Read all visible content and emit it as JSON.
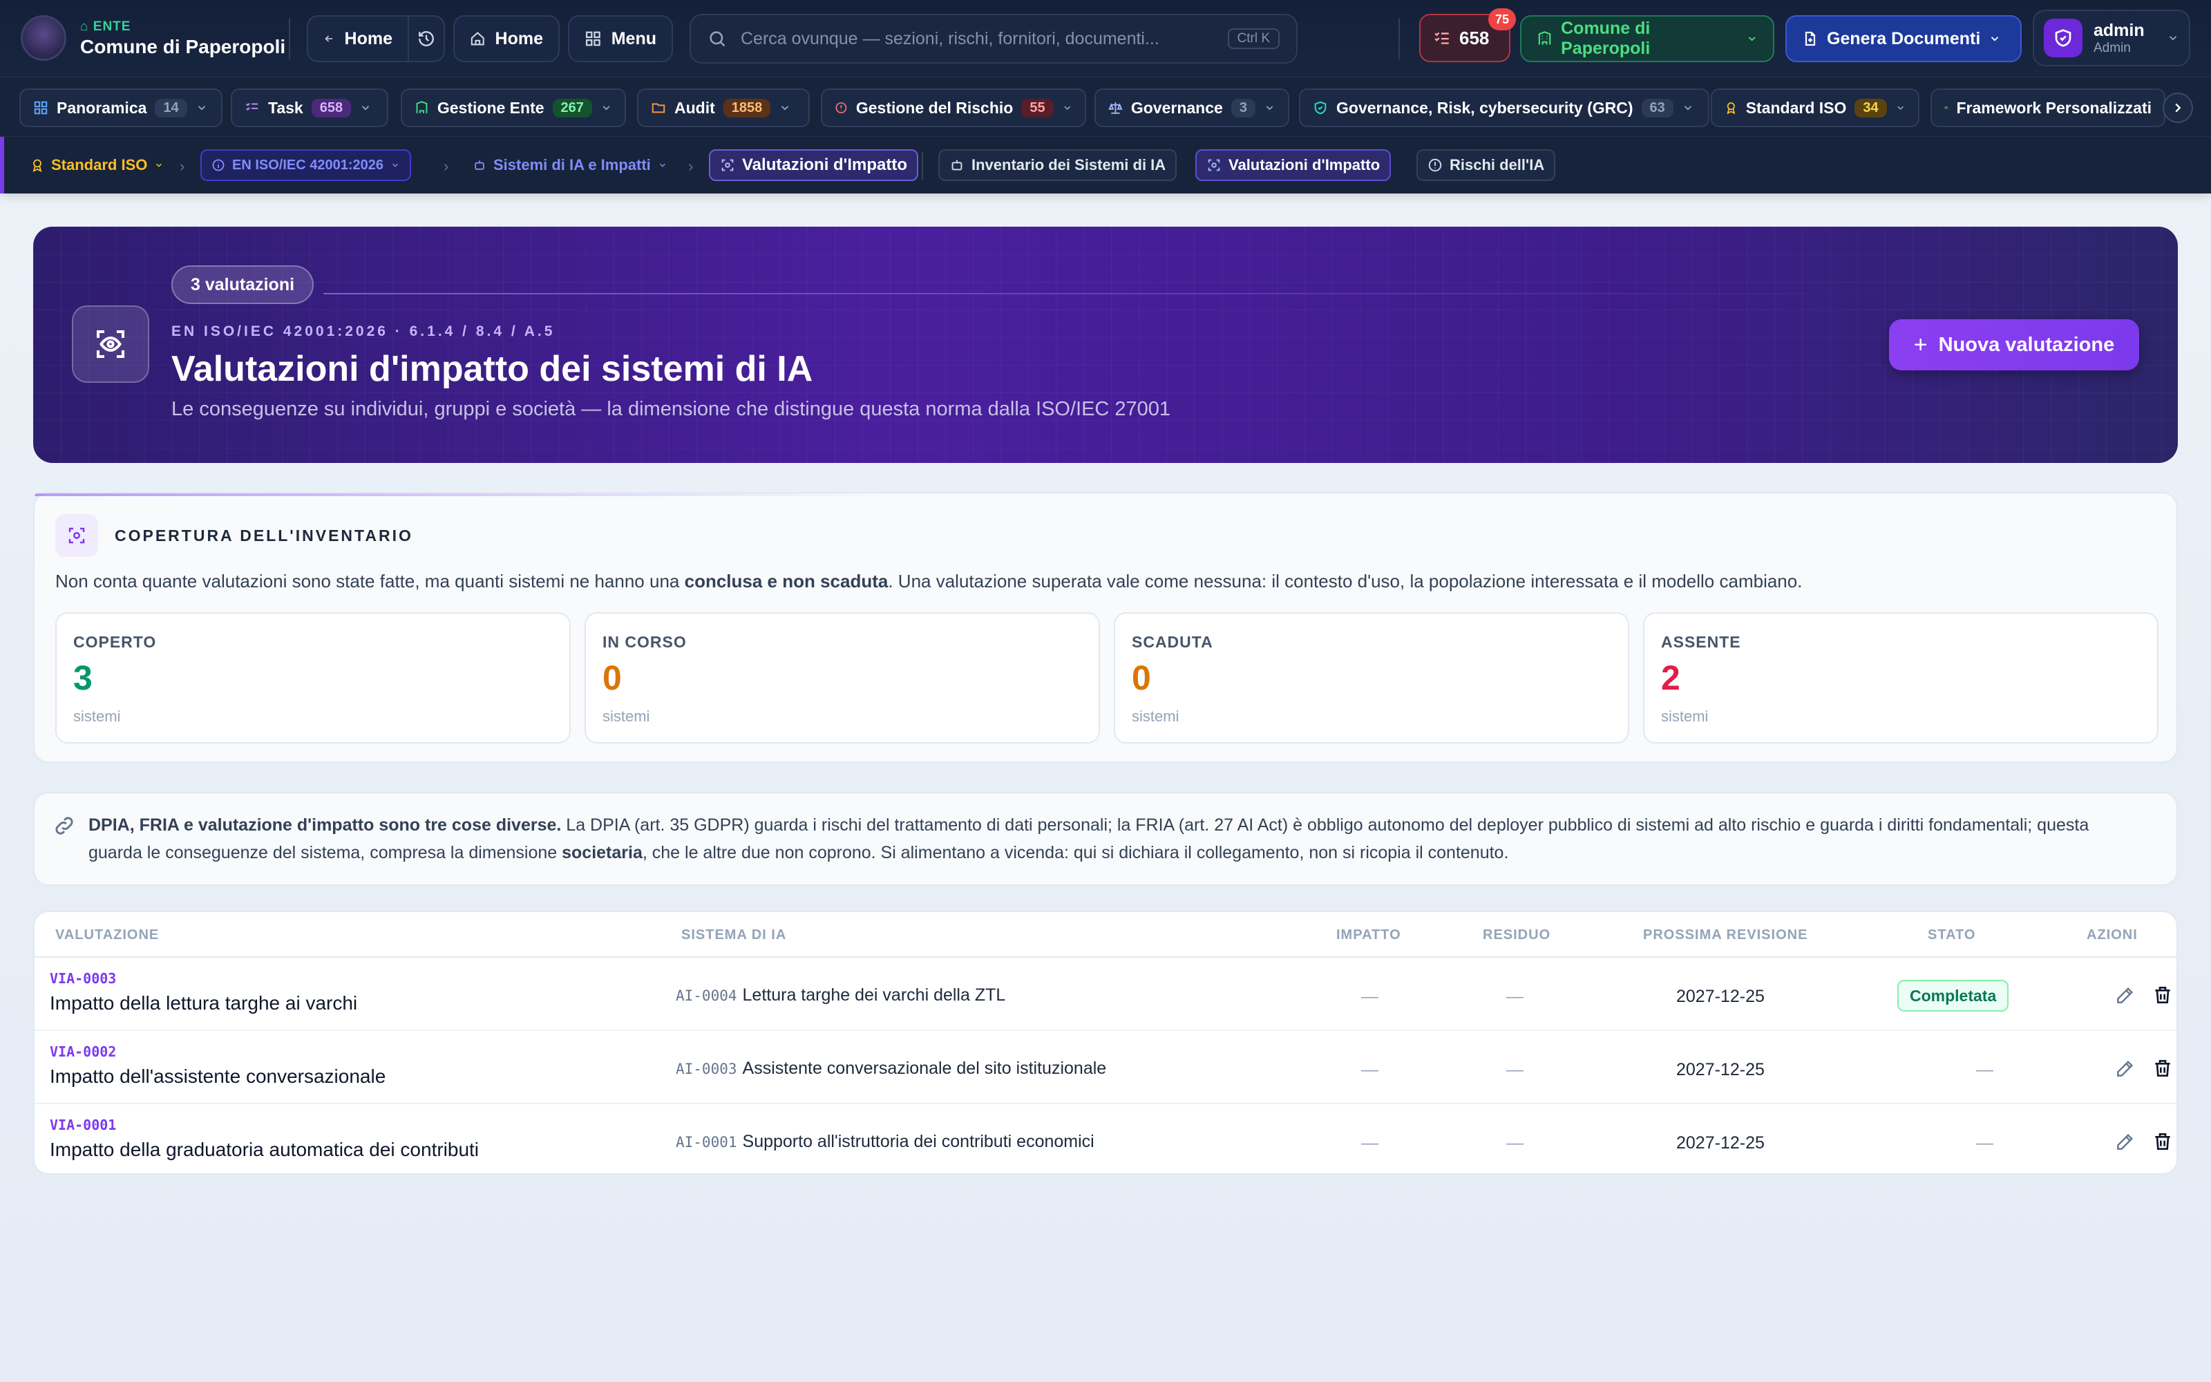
{
  "header": {
    "ente_label": "ENTE",
    "ente_name": "Comune di Paperopoli",
    "back_label": "Home",
    "home_label": "Home",
    "menu_label": "Menu",
    "search_placeholder": "Cerca ovunque — sezioni, rischi, fornitori, documenti...",
    "search_shortcut": "Ctrl K",
    "tasks_count": "658",
    "tasks_badge": "75",
    "ente_selector": "Comune di Paperopoli",
    "generate_label": "Genera Documenti",
    "user_name": "admin",
    "user_role": "Admin"
  },
  "modules": [
    {
      "label": "Panoramica",
      "count": "14",
      "color": "#60a5fa",
      "count_bg": "#2c3a57",
      "count_color": "#94a3b8"
    },
    {
      "label": "Task",
      "count": "658",
      "color": "#c084fc",
      "count_bg": "#4c2a7a",
      "count_color": "#d8b4fe"
    },
    {
      "label": "Gestione Ente",
      "count": "267",
      "color": "#4ade80",
      "count_bg": "#14532d",
      "count_color": "#86efac"
    },
    {
      "label": "Audit",
      "count": "1858",
      "color": "#fb923c",
      "count_bg": "#5a3218",
      "count_color": "#fdba74"
    },
    {
      "label": "Gestione del Rischio",
      "count": "55",
      "color": "#f87171",
      "count_bg": "#5a1d2a",
      "count_color": "#fca5a5"
    },
    {
      "label": "Governance",
      "count": "3",
      "color": "#a5b4fc",
      "count_bg": "#2c3a57",
      "count_color": "#94a3b8"
    },
    {
      "label": "Governance, Risk, cybersecurity (GRC)",
      "count": "63",
      "color": "#2dd4bf",
      "count_bg": "#2c3a57",
      "count_color": "#94a3b8"
    },
    {
      "label": "Standard ISO",
      "count": "34",
      "color": "#fbbf24",
      "count_bg": "#5a4310",
      "count_color": "#fcd34d"
    },
    {
      "label": "Framework Personalizzati",
      "count": "",
      "color": "#a3e635",
      "count_bg": "#2c3a57",
      "count_color": "#94a3b8"
    }
  ],
  "breadcrumb": {
    "items": [
      "Standard ISO",
      "EN ISO/IEC 42001:2026",
      "Sistemi di IA e Impatti",
      "Valutazioni d'Impatto"
    ],
    "subtabs": [
      "Inventario dei Sistemi di IA",
      "Valutazioni d'Impatto",
      "Rischi dell'IA"
    ]
  },
  "hero": {
    "pill": "3 valutazioni",
    "eyebrow": "EN ISO/IEC 42001:2026 · 6.1.4 / 8.4 / A.5",
    "title": "Valutazioni d'impatto dei sistemi di IA",
    "subtitle": "Le conseguenze su individui, gruppi e società — la dimensione che distingue questa norma dalla ISO/IEC 27001",
    "new_button": "Nuova valutazione"
  },
  "coverage": {
    "title": "COPERTURA DELL'INVENTARIO",
    "text_before": "Non conta quante valutazioni sono state fatte, ma quanti sistemi ne hanno una ",
    "text_bold": "conclusa e non scaduta",
    "text_after": ". Una valutazione superata vale come nessuna: il contesto d'uso, la popolazione interessata e il modello cambiano.",
    "stats": [
      {
        "label": "COPERTO",
        "value": "3",
        "unit": "sistemi",
        "color": "#059669"
      },
      {
        "label": "IN CORSO",
        "value": "0",
        "unit": "sistemi",
        "color": "#d97706"
      },
      {
        "label": "SCADUTA",
        "value": "0",
        "unit": "sistemi",
        "color": "#d97706"
      },
      {
        "label": "ASSENTE",
        "value": "2",
        "unit": "sistemi",
        "color": "#e11d48"
      }
    ]
  },
  "info": {
    "bold1": "DPIA, FRIA e valutazione d'impatto sono tre cose diverse.",
    "text1": " La DPIA (art. 35 GDPR) guarda i rischi del trattamento di dati personali; la FRIA (art. 27 AI Act) è obbligo autonomo del deployer pubblico di sistemi ad alto rischio e guarda i diritti fondamentali; questa guarda le conseguenze del sistema, compresa la dimensione ",
    "bold2": "societaria",
    "text2": ", che le altre due non coprono. Si alimentano a vicenda: qui si dichiara il collegamento, non si ricopia il contenuto."
  },
  "table": {
    "headers": {
      "valutazione": "VALUTAZIONE",
      "sistema": "SISTEMA DI IA",
      "impatto": "IMPATTO",
      "residuo": "RESIDUO",
      "revisione": "PROSSIMA REVISIONE",
      "stato": "STATO",
      "azioni": "AZIONI"
    },
    "rows": [
      {
        "id": "VIA-0003",
        "name": "Impatto della lettura targhe ai varchi",
        "system_code": "AI-0004",
        "system_name": "Lettura targhe dei varchi della ZTL",
        "impact": "—",
        "residual": "—",
        "review": "2027-12-25",
        "status": "Completata"
      },
      {
        "id": "VIA-0002",
        "name": "Impatto dell'assistente conversazionale",
        "system_code": "AI-0003",
        "system_name": "Assistente conversazionale del sito istituzionale",
        "impact": "—",
        "residual": "—",
        "review": "2027-12-25",
        "status": "—"
      },
      {
        "id": "VIA-0001",
        "name": "Impatto della graduatoria automatica dei contributi",
        "system_code": "AI-0001",
        "system_name": "Supporto all'istruttoria dei contributi economici",
        "impact": "—",
        "residual": "—",
        "review": "2027-12-25",
        "status": "—"
      }
    ]
  }
}
